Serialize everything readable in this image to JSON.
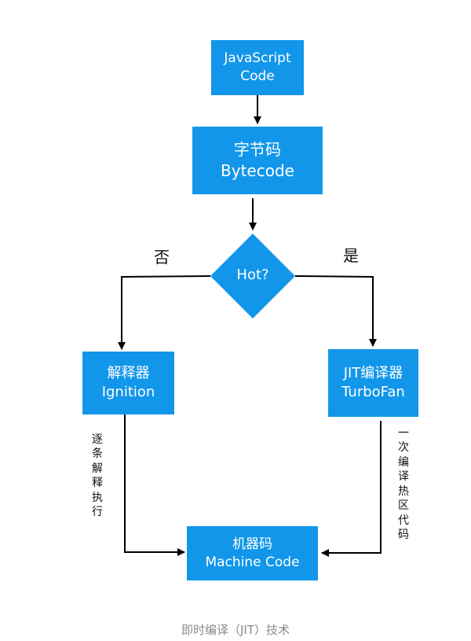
{
  "nodes": {
    "js_code": {
      "line1": "JavaScript",
      "line2": "Code"
    },
    "bytecode": {
      "line1": "字节码",
      "line2": "Bytecode"
    },
    "decision": {
      "label": "Hot?"
    },
    "interpreter": {
      "line1": "解释器",
      "line2": "Ignition"
    },
    "compiler": {
      "line1": "JIT编译器",
      "line2": "TurboFan"
    },
    "machine_code": {
      "line1": "机器码",
      "line2": "Machine Code"
    }
  },
  "edge_labels": {
    "no": "否",
    "yes": "是"
  },
  "side_notes": {
    "left": [
      "逐",
      "条",
      "解",
      "释",
      "执",
      "行"
    ],
    "right": [
      "一",
      "次",
      "编",
      "译",
      "热",
      "区",
      "代",
      "码"
    ]
  },
  "caption": "即时编译（JIT）技术",
  "colors": {
    "node_fill": "#1296ea",
    "node_text": "#ffffff",
    "arrow": "#000000",
    "caption": "#8a8a8a"
  }
}
